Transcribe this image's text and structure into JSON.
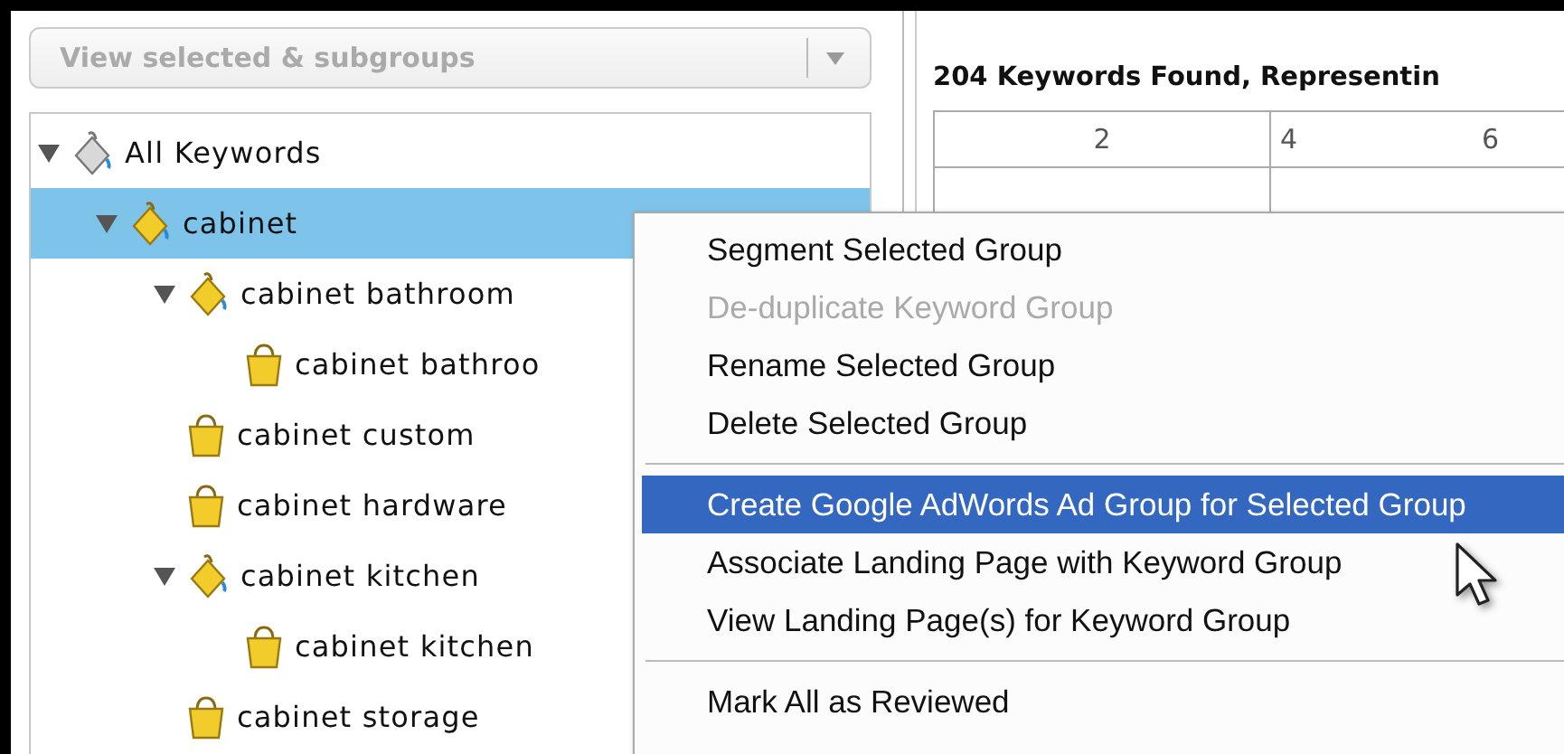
{
  "view_dropdown": {
    "value": "View selected & subgroups"
  },
  "tree": [
    {
      "label": "All Keywords",
      "selected": false,
      "expanded": true,
      "children": [
        {
          "label": "cabinet",
          "selected": true,
          "expanded": true,
          "children": [
            {
              "label": "cabinet bathroom",
              "selected": false,
              "expanded": true,
              "children": [
                {
                  "label": "cabinet bathroo",
                  "selected": false
                }
              ]
            },
            {
              "label": "cabinet custom",
              "selected": false
            },
            {
              "label": "cabinet hardware",
              "selected": false
            },
            {
              "label": "cabinet kitchen",
              "selected": false,
              "expanded": true,
              "children": [
                {
                  "label": "cabinet kitchen",
                  "selected": false
                }
              ]
            },
            {
              "label": "cabinet storage",
              "selected": false
            }
          ]
        }
      ]
    }
  ],
  "results": {
    "heading": "204 Keywords Found, Representin",
    "ruler": [
      "2",
      "4",
      "6"
    ]
  },
  "context_menu": [
    {
      "kind": "item",
      "label": "Segment Selected Group",
      "disabled": false,
      "selected": false
    },
    {
      "kind": "item",
      "label": "De-duplicate Keyword Group",
      "disabled": true,
      "selected": false
    },
    {
      "kind": "item",
      "label": "Rename Selected Group",
      "disabled": false,
      "selected": false
    },
    {
      "kind": "item",
      "label": "Delete Selected Group",
      "disabled": false,
      "selected": false
    },
    {
      "kind": "separator"
    },
    {
      "kind": "item",
      "label": "Create Google AdWords Ad Group for Selected Group",
      "disabled": false,
      "selected": true
    },
    {
      "kind": "item",
      "label": "Associate Landing Page with Keyword Group",
      "disabled": false,
      "selected": false
    },
    {
      "kind": "item",
      "label": "View Landing Page(s) for Keyword Group",
      "disabled": false,
      "selected": false
    },
    {
      "kind": "separator"
    },
    {
      "kind": "item",
      "label": "Mark All as Reviewed",
      "disabled": false,
      "selected": false
    }
  ]
}
